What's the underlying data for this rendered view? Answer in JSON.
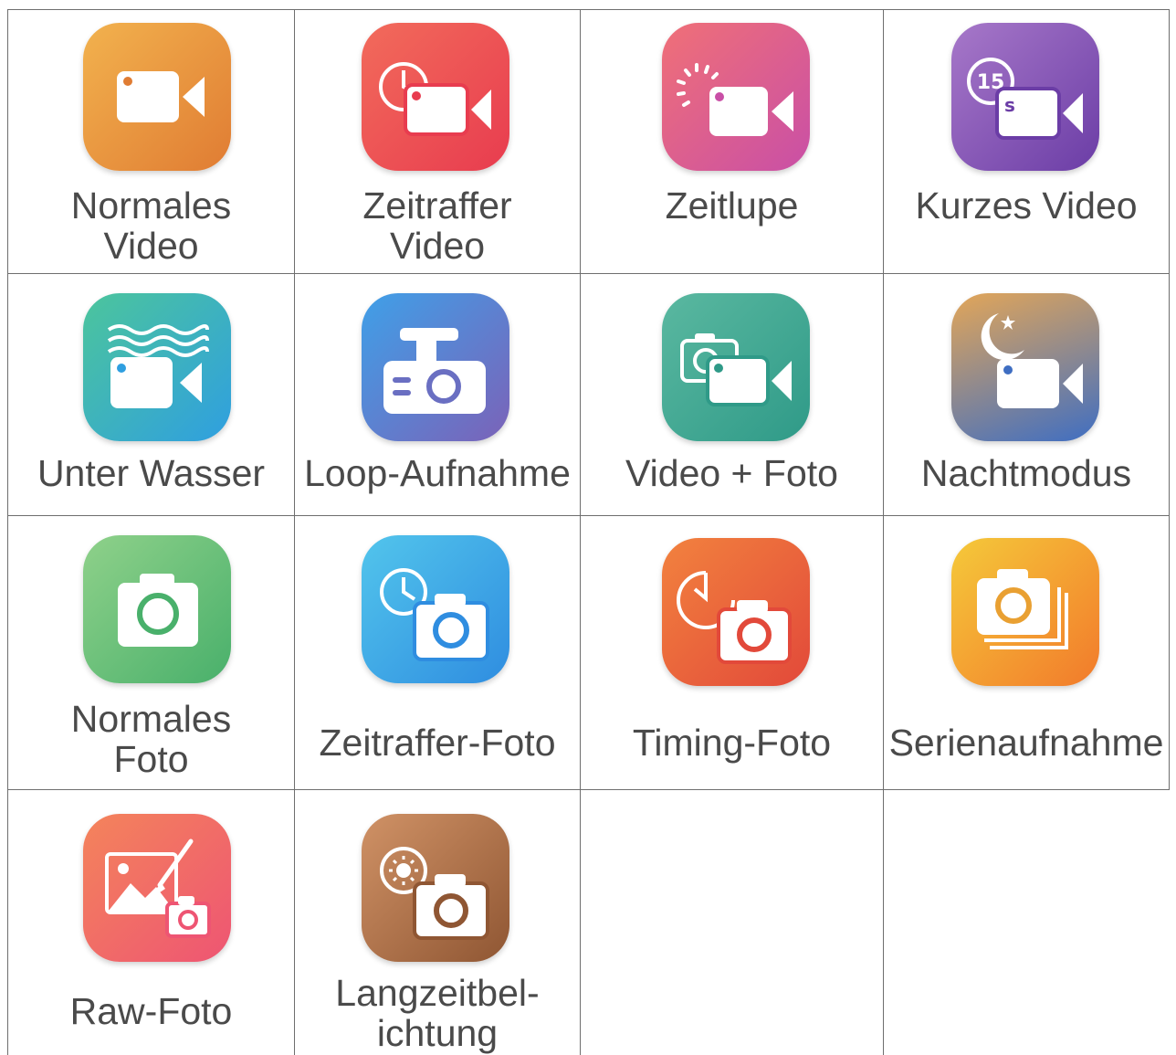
{
  "modes": [
    {
      "id": "normal-video",
      "lines": [
        "Normales",
        "Video"
      ],
      "icon": "video-camera-icon",
      "colors": [
        "#f2b24e",
        "#e07c33"
      ]
    },
    {
      "id": "timelapse-video",
      "lines": [
        "Zeitraffer",
        "Video"
      ],
      "icon": "timelapse-video-icon",
      "colors": [
        "#f26b5b",
        "#e83c4f"
      ]
    },
    {
      "id": "slow-motion",
      "lines": [
        "Zeitlupe"
      ],
      "icon": "slow-motion-icon",
      "colors": [
        "#f07077",
        "#c94fa6"
      ]
    },
    {
      "id": "short-video",
      "lines": [
        "Kurzes Video"
      ],
      "icon": "short-video-icon",
      "colors": [
        "#a778c9",
        "#6b3da6"
      ]
    },
    {
      "id": "underwater",
      "lines": [
        "Unter Wasser"
      ],
      "icon": "underwater-icon",
      "colors": [
        "#4cc59c",
        "#2f9fe0"
      ]
    },
    {
      "id": "loop-recording",
      "lines": [
        "Loop-Aufnahme"
      ],
      "icon": "dashcam-icon",
      "colors": [
        "#3fa0e8",
        "#7b62b8"
      ]
    },
    {
      "id": "video-photo",
      "lines": [
        "Video + Foto"
      ],
      "icon": "video-photo-icon",
      "colors": [
        "#5ab8a0",
        "#2f9a88"
      ]
    },
    {
      "id": "night-mode",
      "lines": [
        "Nachtmodus"
      ],
      "icon": "night-mode-icon",
      "colors": [
        "#e3a658",
        "#3f6ec2"
      ]
    },
    {
      "id": "normal-photo",
      "lines": [
        "Normales",
        "Foto"
      ],
      "icon": "camera-icon",
      "colors": [
        "#8fd18a",
        "#49b06b"
      ]
    },
    {
      "id": "timelapse-photo",
      "lines": [
        "Zeitraffer-Foto"
      ],
      "icon": "timelapse-photo-icon",
      "colors": [
        "#52c5ec",
        "#2f8de0"
      ]
    },
    {
      "id": "timing-photo",
      "lines": [
        "Timing-Foto"
      ],
      "icon": "timer-photo-icon",
      "colors": [
        "#f2823e",
        "#e2493a"
      ]
    },
    {
      "id": "burst",
      "lines": [
        "Serienaufnahme"
      ],
      "icon": "burst-photo-icon",
      "colors": [
        "#f5c93a",
        "#f27a2b"
      ]
    },
    {
      "id": "raw-photo",
      "lines": [
        "Raw-Foto"
      ],
      "icon": "raw-photo-icon",
      "colors": [
        "#f4845b",
        "#ee5573"
      ]
    },
    {
      "id": "long-exposure",
      "lines": [
        "Langzeitbel-",
        "ichtung"
      ],
      "icon": "long-exposure-icon",
      "colors": [
        "#d09266",
        "#8f5633"
      ]
    }
  ]
}
